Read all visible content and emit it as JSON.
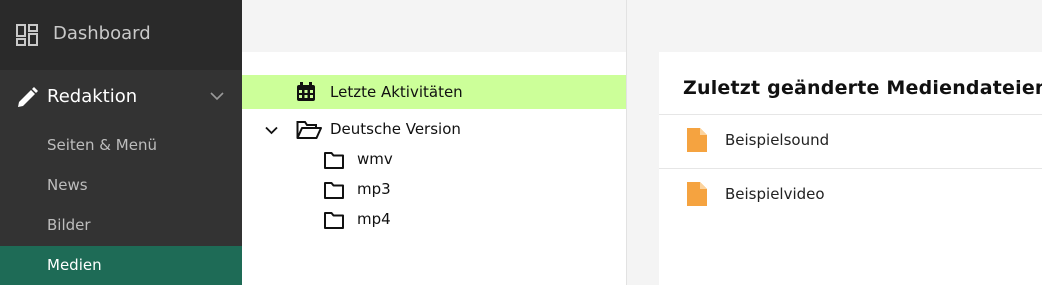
{
  "sidebar": {
    "dashboard": {
      "label": "Dashboard",
      "icon": "dashboard-icon"
    },
    "redaktion": {
      "label": "Redaktion",
      "icon": "pencil-icon"
    },
    "items": [
      {
        "label": "Seiten & Menü"
      },
      {
        "label": "News"
      },
      {
        "label": "Bilder"
      },
      {
        "label": "Medien",
        "active": true
      }
    ],
    "active_color": "#1e6b56"
  },
  "tree": {
    "recent": {
      "label": "Letzte Aktivitäten",
      "icon": "calendar-icon",
      "highlight_color": "#ccff99"
    },
    "root": {
      "label": "Deutsche Version",
      "icon": "folder-open-icon",
      "expanded": true
    },
    "folders": [
      {
        "label": "wmv",
        "icon": "folder-icon"
      },
      {
        "label": "mp3",
        "icon": "folder-icon"
      },
      {
        "label": "mp4",
        "icon": "folder-icon"
      }
    ]
  },
  "recent_panel": {
    "title": "Zuletzt geänderte Mediendateien",
    "files": [
      {
        "label": "Beispielsound",
        "icon": "file-icon"
      },
      {
        "label": "Beispielvideo",
        "icon": "file-icon"
      }
    ],
    "file_icon_color": "#f5a340"
  }
}
